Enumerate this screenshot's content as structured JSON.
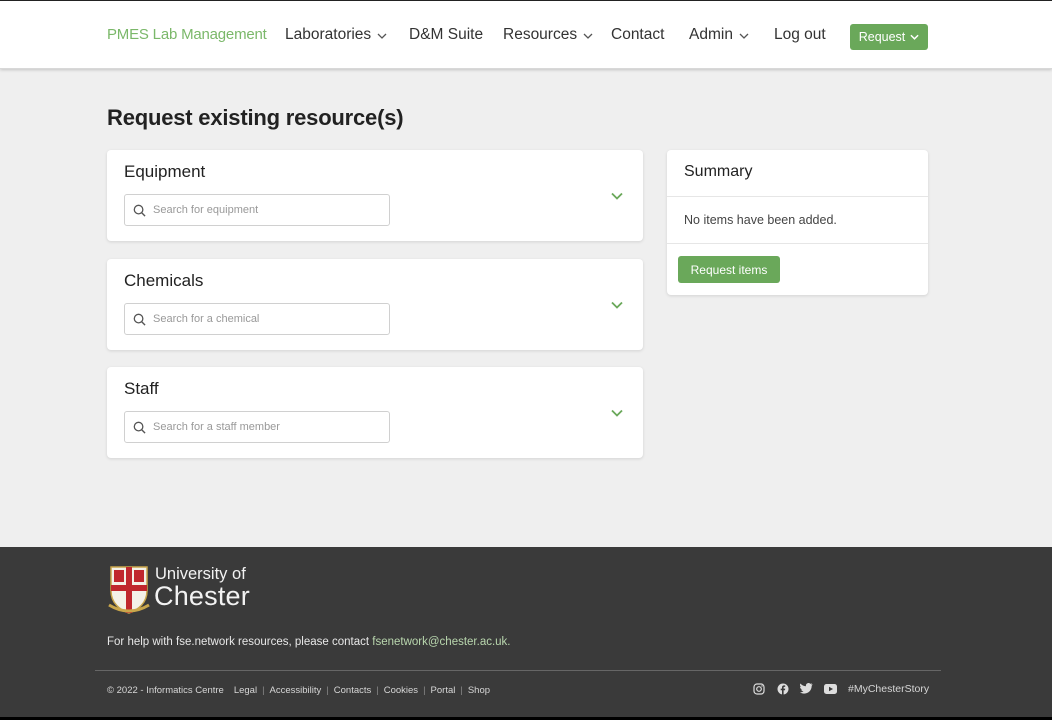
{
  "nav": {
    "brand": "PMES Lab Management",
    "items": [
      {
        "label": "Laboratories",
        "dropdown": true
      },
      {
        "label": "D&M Suite",
        "dropdown": false
      },
      {
        "label": "Resources",
        "dropdown": true
      },
      {
        "label": "Contact",
        "dropdown": false
      },
      {
        "label": "Admin",
        "dropdown": true
      },
      {
        "label": "Log out",
        "dropdown": false
      }
    ],
    "request_button": "Request"
  },
  "page_title": "Request existing resource(s)",
  "sections": [
    {
      "title": "Equipment",
      "placeholder": "Search for equipment"
    },
    {
      "title": "Chemicals",
      "placeholder": "Search for a chemical"
    },
    {
      "title": "Staff",
      "placeholder": "Search for a staff member"
    }
  ],
  "summary": {
    "title": "Summary",
    "empty_text": "No items have been added.",
    "button": "Request items"
  },
  "footer": {
    "logo_line1": "University of",
    "logo_line2": "Chester",
    "help_text": "For help with fse.network resources, please contact ",
    "help_email": "fsenetwork@chester.ac.uk.",
    "copyright": "© 2022 - Informatics Centre",
    "links": [
      "Legal",
      "Accessibility",
      "Contacts",
      "Cookies",
      "Portal",
      "Shop"
    ],
    "socials": [
      "instagram-icon",
      "facebook-icon",
      "twitter-icon",
      "youtube-icon"
    ],
    "hashtag": "#MyChesterStory"
  },
  "colors": {
    "accent": "#6aa85a",
    "brand": "#7bb86a",
    "footer_bg": "#3a3a3a",
    "page_bg": "#efefef"
  }
}
